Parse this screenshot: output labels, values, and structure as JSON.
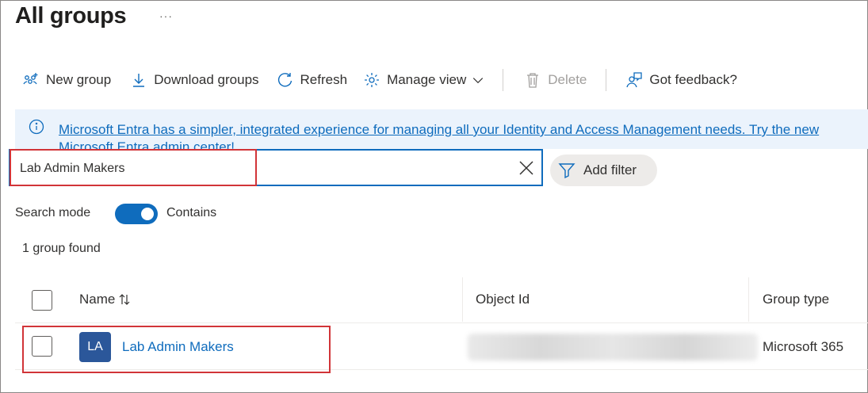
{
  "page": {
    "title": "All groups",
    "more_label": "···"
  },
  "toolbar": {
    "new_group": "New group",
    "download_groups": "Download groups",
    "refresh": "Refresh",
    "manage_view": "Manage view",
    "delete": "Delete",
    "got_feedback": "Got feedback?"
  },
  "banner": {
    "text": "Microsoft Entra has a simpler, integrated experience for managing all your Identity and Access Management needs. Try the new Microsoft Entra admin center!"
  },
  "search": {
    "value": "Lab Admin Makers"
  },
  "filter": {
    "add_filter": "Add filter"
  },
  "search_mode": {
    "label": "Search mode",
    "value": "Contains",
    "on": true
  },
  "results": {
    "count_text": "1 group found"
  },
  "table": {
    "columns": {
      "name": "Name",
      "object_id": "Object Id",
      "group_type": "Group type"
    },
    "rows": [
      {
        "initials": "LA",
        "name": "Lab Admin Makers",
        "object_id": "",
        "group_type": "Microsoft 365"
      }
    ]
  },
  "colors": {
    "accent": "#0f6cbd",
    "highlight": "#d13438",
    "avatar": "#2b579a",
    "banner_bg": "#ebf3fc"
  }
}
